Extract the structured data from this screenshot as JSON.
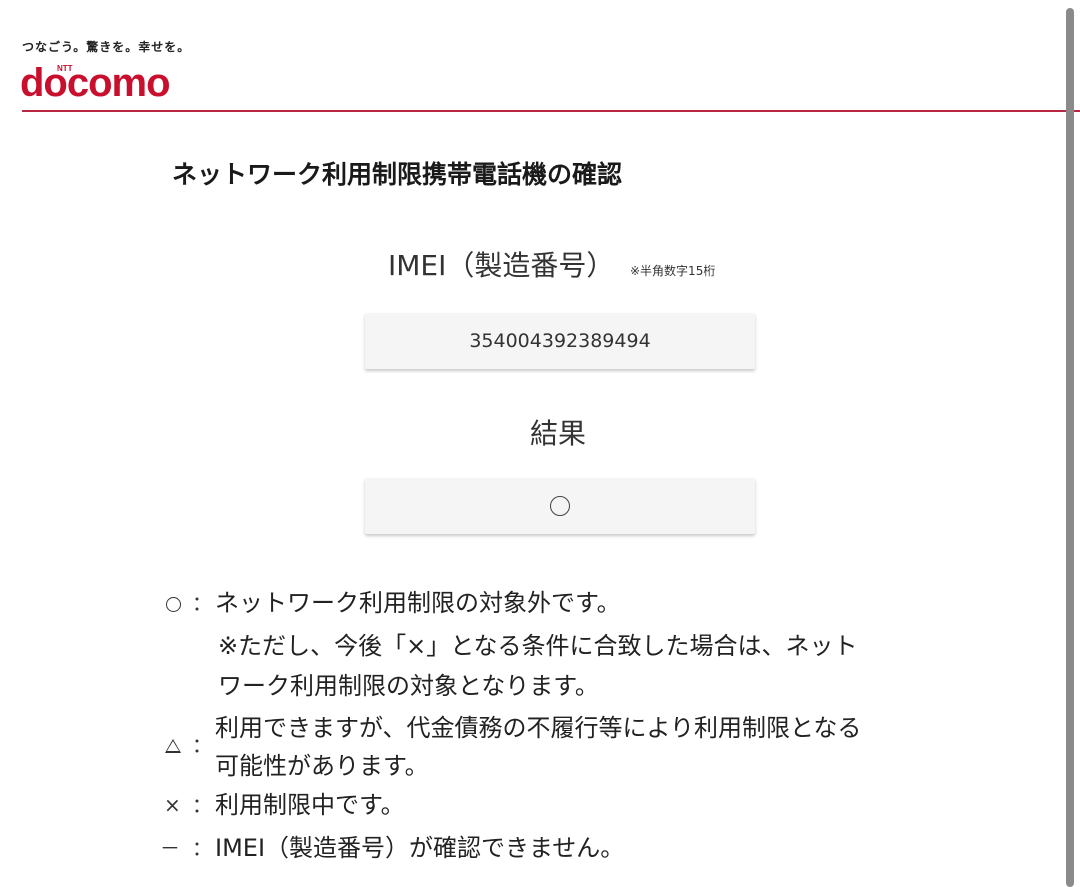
{
  "header": {
    "tagline": "つなごう。驚きを。幸せを。",
    "logo_prefix": "NTT",
    "logo_word": "docomo",
    "brand_color": "#c8102e"
  },
  "main": {
    "title": "ネットワーク利用制限携帯電話機の確認",
    "imei_label": "IMEI（製造番号）",
    "imei_note": "※半角数字15桁",
    "imei_value": "354004392389494",
    "result_label": "結果",
    "result_value": "circle"
  },
  "legend": {
    "circle": {
      "symbol": "○",
      "text": "ネットワーク利用制限の対象外です。",
      "note_line1": "※ただし、今後「×」となる条件に合致した場合は、ネット",
      "note_line2": "ワーク利用制限の対象となります。"
    },
    "triangle": {
      "symbol": "△",
      "line1": "利用できますが、代金債務の不履行等により利用制限となる",
      "line2": "可能性があります。"
    },
    "cross": {
      "symbol": "×",
      "text": "利用制限中です。"
    },
    "dash": {
      "symbol": "－",
      "text": "IMEI（製造番号）が確認できません。"
    },
    "separator": "："
  }
}
